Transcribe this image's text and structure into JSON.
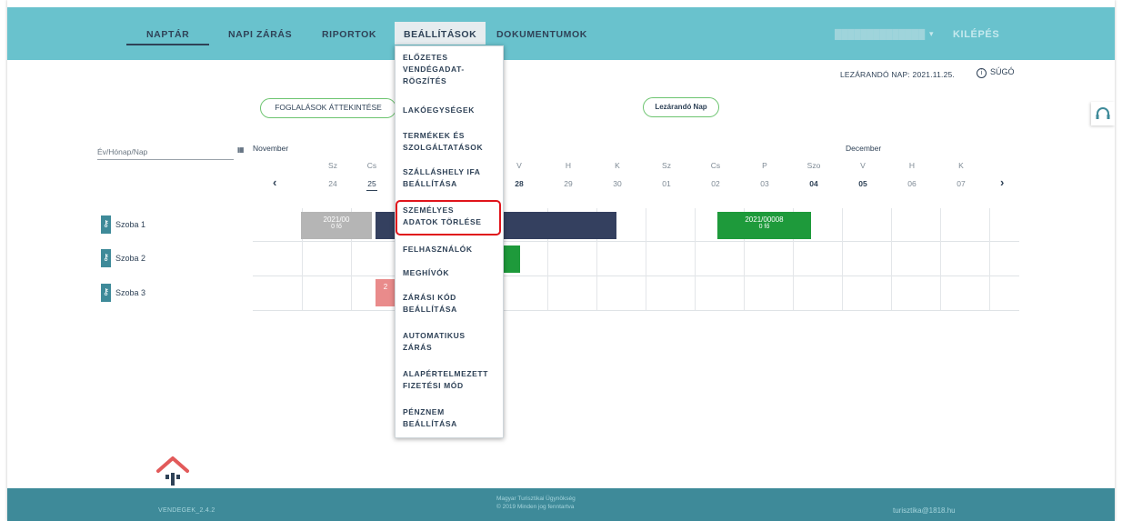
{
  "nav": {
    "items": [
      {
        "label": "NAPTÁR"
      },
      {
        "label": "NAPI ZÁRÁS"
      },
      {
        "label": "RIPORTOK"
      },
      {
        "label": "BEÁLLÍTÁSOK"
      },
      {
        "label": "DOKUMENTUMOK"
      }
    ],
    "caret": "▾",
    "logout": "KILÉPÉS"
  },
  "header": {
    "lezarando": "LEZÁRANDÓ NAP: 2021.11.25.",
    "sugo": "SÚGÓ",
    "sugo_icon": "info-circle-icon"
  },
  "buttons": {
    "foglalasok": "FOGLALÁSOK ÁTTEKINTÉSE",
    "lezarando_nap": "Lezárandó Nap"
  },
  "date_input": {
    "placeholder": "Év/Hónap/Nap"
  },
  "calendar": {
    "months": [
      "November",
      "December"
    ],
    "days": [
      {
        "name": "Sz",
        "num": "24"
      },
      {
        "name": "Cs",
        "num": "25"
      },
      {
        "name": "",
        "num": ""
      },
      {
        "name": "",
        "num": ""
      },
      {
        "name": "",
        "num": ""
      },
      {
        "name": "V",
        "num": "28"
      },
      {
        "name": "H",
        "num": "29"
      },
      {
        "name": "K",
        "num": "30"
      },
      {
        "name": "Sz",
        "num": "01"
      },
      {
        "name": "Cs",
        "num": "02"
      },
      {
        "name": "P",
        "num": "03"
      },
      {
        "name": "Szo",
        "num": "04"
      },
      {
        "name": "V",
        "num": "05"
      },
      {
        "name": "H",
        "num": "06"
      },
      {
        "name": "K",
        "num": "07"
      }
    ],
    "prev": "‹",
    "next": "›"
  },
  "rooms": [
    {
      "name": "Szoba 1"
    },
    {
      "name": "Szoba 2"
    },
    {
      "name": "Szoba 3"
    }
  ],
  "bookings": [
    {
      "id": "2021/00",
      "guests": "0 fő",
      "color": "#b5b5b5"
    },
    {
      "id": "2021/00008",
      "guests": "0 fő",
      "color": "#1e9a3b"
    },
    {
      "id": "2",
      "guests": "",
      "color": "#e98b8b"
    }
  ],
  "dropdown": {
    "items": [
      "ELŐZETES\nVENDÉGADAT-\nRÖGZÍTÉS",
      "LAKÓEGYSÉGEK",
      "TERMÉKEK ÉS\nSZOLGÁLTATÁSOK",
      "SZÁLLÁSHELY IFA\nBEÁLLÍTÁSA",
      "SZEMÉLYES\nADATOK TÖRLÉSE",
      "FELHASZNÁLÓK",
      "MEGHÍVÓK",
      "ZÁRÁSI KÓD\nBEÁLLÍTÁSA",
      "AUTOMATIKUS\nZÁRÁS",
      "ALAPÉRTELMEZETT\nFIZETÉSI MÓD",
      "PÉNZNEM\nBEÁLLÍTÁSA"
    ]
  },
  "footer": {
    "version": "VENDEGEK_2.4.2",
    "org": "Magyar Turisztikai Ügynökség",
    "copyright": "© 2019 Minden jog fenntartva",
    "mail": "turisztika@1818.hu"
  },
  "colors": {
    "nav_bg": "#69c2cd",
    "footer_bg": "#3e8a99",
    "navy_booking": "#34405f",
    "green": "#1e9a3b",
    "highlight": "#e0141b"
  }
}
